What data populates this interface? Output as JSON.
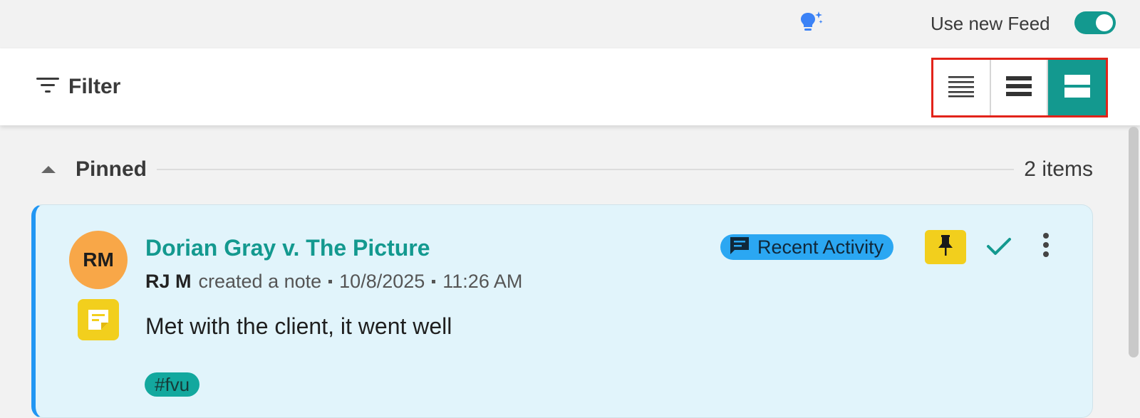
{
  "topbar": {
    "icon": "lightbulb-sparkle-icon",
    "feed_toggle_label": "Use new Feed",
    "feed_toggle_on": true
  },
  "toolbar": {
    "filter_label": "Filter",
    "filter_icon": "filter-lines-icon",
    "view_options": [
      {
        "name": "compact-view",
        "icon": "compact-lines-icon",
        "active": false
      },
      {
        "name": "standard-view",
        "icon": "standard-lines-icon",
        "active": false
      },
      {
        "name": "expanded-view",
        "icon": "expanded-rows-icon",
        "active": true
      }
    ]
  },
  "pinned": {
    "label": "Pinned",
    "count": "2 items"
  },
  "card": {
    "avatar_initials": "RM",
    "title": "Dorian Gray v. The Picture",
    "author": "RJ M",
    "action": "created a note",
    "date": "10/8/2025",
    "time": "11:26 AM",
    "body": "Met with the client, it went well",
    "tag": "#fvu",
    "badge_label": "Recent Activity",
    "colors": {
      "accent": "#13998f",
      "badge": "#2ba7f2",
      "pin": "#f2cf1d",
      "avatar": "#f8a748",
      "card_bg": "#e1f4fb",
      "card_border_left": "#2196f3"
    }
  }
}
